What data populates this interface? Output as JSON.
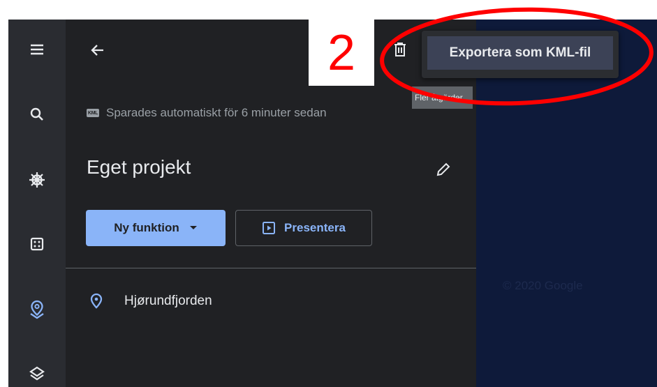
{
  "annotation": {
    "step_number": "2",
    "highlight_color": "#ff0000"
  },
  "rail": {
    "items": [
      {
        "icon": "menu-icon"
      },
      {
        "icon": "search-icon"
      },
      {
        "icon": "steering-wheel-icon"
      },
      {
        "icon": "dice-icon"
      },
      {
        "icon": "projects-pin-icon",
        "active": true
      },
      {
        "icon": "layers-icon"
      }
    ]
  },
  "panel": {
    "back_icon": "arrow-left-icon",
    "autosave": {
      "badge": "KML",
      "text": "Sparades automatiskt för 6 minuter sedan"
    },
    "project_title": "Eget projekt",
    "edit_icon": "pencil-icon",
    "new_feature_label": "Ny funktion",
    "present_label": "Presentera",
    "features": [
      {
        "icon": "place-pin-icon",
        "name": "Hjørundfjorden"
      }
    ],
    "trash_icon": "trash-icon",
    "tooltip": "Fler åtgärder"
  },
  "export_menu": {
    "item_label": "Exportera som KML-fil"
  },
  "map": {
    "copyright": "© 2020 Google"
  },
  "colors": {
    "accent": "#8ab4f8",
    "panel_bg": "#202124",
    "rail_bg": "#2a2c31",
    "map_bg": "#0e1a3a"
  }
}
